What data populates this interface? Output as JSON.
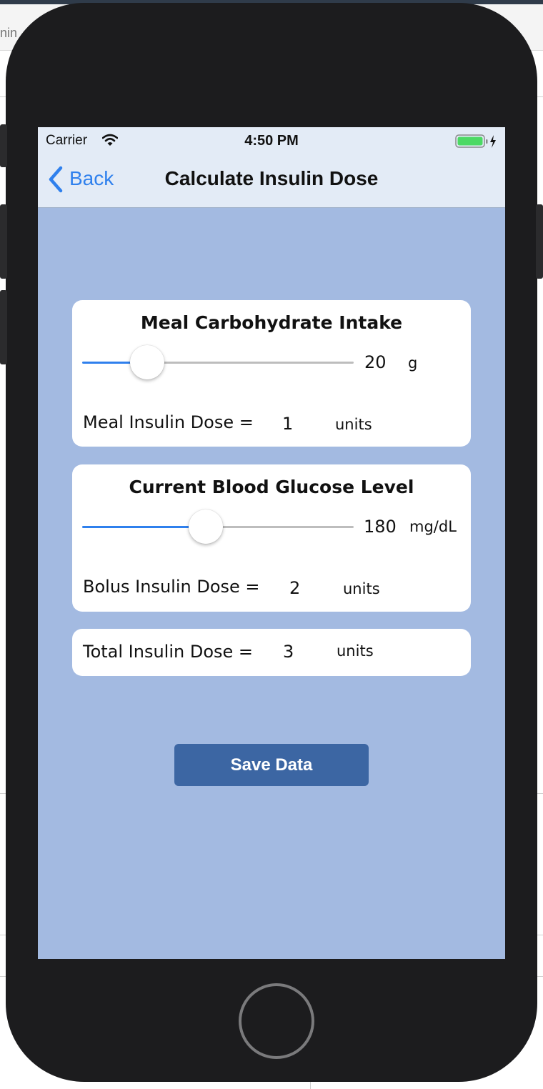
{
  "backdrop": {
    "tab_fragment": "nin"
  },
  "status_bar": {
    "carrier": "Carrier",
    "time": "4:50 PM"
  },
  "nav": {
    "back_label": "Back",
    "title": "Calculate Insulin Dose"
  },
  "carb_card": {
    "title": "Meal Carbohydrate Intake",
    "slider_fraction": 0.24,
    "value": "20",
    "unit": "g",
    "dose_label": "Meal Insulin Dose =",
    "dose_value": "1",
    "dose_unit": "units"
  },
  "glucose_card": {
    "title": "Current Blood Glucose Level",
    "slider_fraction": 0.46,
    "value": "180",
    "unit": "mg/dL",
    "dose_label": "Bolus Insulin Dose =",
    "dose_value": "2",
    "dose_unit": "units"
  },
  "total_card": {
    "label": "Total Insulin Dose =",
    "value": "3",
    "unit": "units"
  },
  "save_button": {
    "label": "Save Data"
  },
  "colors": {
    "screen_bg": "#a3bae1",
    "nav_bg": "#e3ebf6",
    "accent": "#2f80ed",
    "button_bg": "#3c66a3",
    "battery": "#4cd964"
  },
  "icons": [
    "wifi-icon",
    "battery-icon",
    "back-chevron-icon"
  ]
}
